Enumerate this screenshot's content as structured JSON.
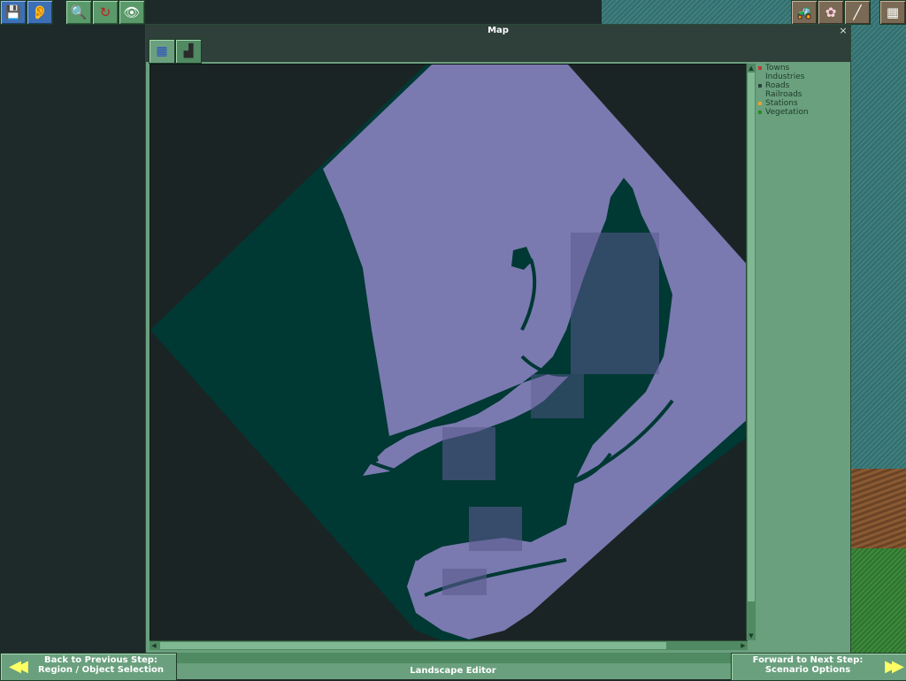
{
  "window": {
    "title": "Map",
    "close_glyph": "×"
  },
  "toolbar": {
    "left_buttons": [
      {
        "name": "save-icon",
        "glyph": "💾"
      },
      {
        "name": "ear-icon",
        "glyph": "👂"
      },
      {
        "name": "magnifier-icon",
        "glyph": "🔍"
      },
      {
        "name": "rotate-icon",
        "glyph": "↻"
      },
      {
        "name": "eye-icon",
        "glyph": "👁"
      }
    ],
    "right_buttons": [
      {
        "name": "bulldozer-icon",
        "glyph": "🚜"
      },
      {
        "name": "flower-icon",
        "glyph": "✿"
      },
      {
        "name": "track-icon",
        "glyph": "╱"
      },
      {
        "name": "building-icon",
        "glyph": "▦"
      }
    ]
  },
  "tabs": [
    {
      "name": "tab-map-overview",
      "icon": "map-grid-icon",
      "glyph": "▦"
    },
    {
      "name": "tab-industries",
      "icon": "factory-icon",
      "glyph": "▟"
    }
  ],
  "legend": {
    "items": [
      {
        "label": "Towns",
        "color": "#cc3333"
      },
      {
        "label": "Industries",
        "color": ""
      },
      {
        "label": "Roads",
        "color": "#2f3f3a"
      },
      {
        "label": "Railroads",
        "color": ""
      },
      {
        "label": "Stations",
        "color": "#e8a030"
      },
      {
        "label": "Vegetation",
        "color": "#2a8a2a"
      }
    ]
  },
  "colors": {
    "water": "#7a7ab0",
    "land": "#003833",
    "void": "#1b2424",
    "panel": "#6aa07e"
  },
  "nav": {
    "back_line1": "Back to Previous Step:",
    "back_line2": "Region / Object Selection",
    "forward_line1": "Forward to Next Step:",
    "forward_line2": "Scenario Options",
    "editor_label": "Landscape Editor"
  }
}
